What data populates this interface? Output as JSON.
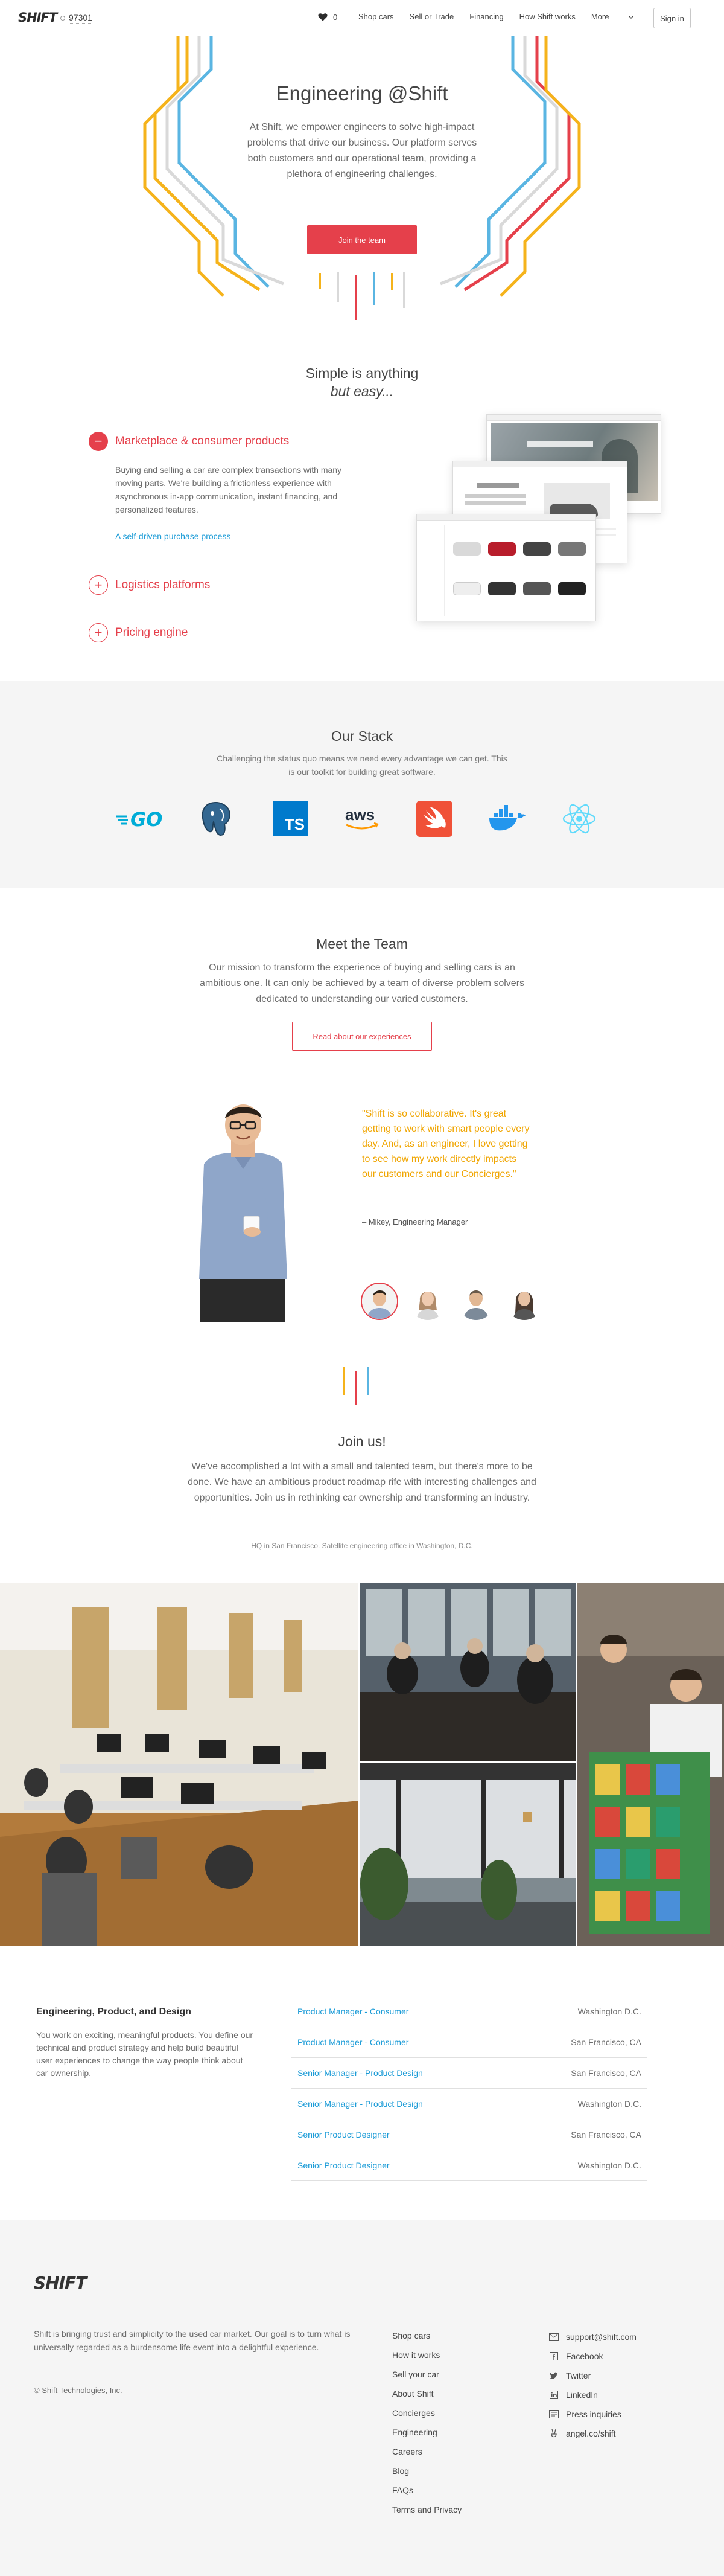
{
  "nav": {
    "logo": "SHIFT",
    "zip": "97301",
    "favorites_count": "0",
    "links": [
      "Shop cars",
      "Sell or Trade",
      "Financing",
      "How Shift works"
    ],
    "more": "More",
    "sign_in": "Sign in"
  },
  "hero": {
    "title": "Engineering @Shift",
    "text": "At Shift, we empower engineers to solve high-impact problems that drive our business. Our platform serves both customers and our operational team, providing a plethora of engineering challenges.",
    "button": "Join the team"
  },
  "simple": {
    "title_line1": "Simple is anything",
    "title_line2": "but easy...",
    "items": [
      {
        "label": "Marketplace & consumer products",
        "body": "Buying and selling a car are complex transactions with many moving parts. We're building a frictionless experience with asynchronous in-app communication, instant financing, and personalized features.",
        "link": "A self-driven purchase process"
      },
      {
        "label": "Logistics platforms"
      },
      {
        "label": "Pricing engine"
      }
    ]
  },
  "stack": {
    "title": "Our Stack",
    "text": "Challenging the status quo means we need every advantage we can get. This is our toolkit for building great software.",
    "logos": [
      "go-logo",
      "postgresql-logo",
      "typescript-logo",
      "aws-logo",
      "swift-logo",
      "docker-logo",
      "react-logo"
    ],
    "go_text": "GO",
    "ts_text": "TS",
    "aws_text": "aws"
  },
  "team": {
    "title": "Meet the Team",
    "text": "Our mission to transform the experience of buying and selling cars is an ambitious one. It can only be achieved by a team of diverse problem solvers dedicated to understanding our varied customers.",
    "button": "Read about our experiences",
    "quote": "\"Shift is so collaborative. It's great getting to work with smart people every day. And, as an engineer, I love getting to see how my work directly impacts our customers and our Concierges.\"",
    "quote_by": "– Mikey, Engineering Manager"
  },
  "join": {
    "title": "Join us!",
    "text": "We've accomplished a lot with a small and talented team, but there's more to be done. We have an ambitious product roadmap rife with interesting challenges and opportunities. Join us in rethinking car ownership and transforming an industry.",
    "hq": "HQ in San Francisco. Satellite engineering office in Washington, D.C."
  },
  "jobs": {
    "category": "Engineering, Product, and Design",
    "description": "You work on exciting, meaningful products. You define our technical and product strategy and help build beautiful user experiences to change the way people think about car ownership.",
    "listings": [
      {
        "title": "Product Manager - Consumer",
        "location": "Washington D.C."
      },
      {
        "title": "Product Manager - Consumer",
        "location": "San Francisco, CA"
      },
      {
        "title": "Senior Manager - Product Design",
        "location": "San Francisco, CA"
      },
      {
        "title": "Senior Manager - Product Design",
        "location": "Washington D.C."
      },
      {
        "title": "Senior Product Designer",
        "location": "San Francisco, CA"
      },
      {
        "title": "Senior Product Designer",
        "location": "Washington D.C."
      }
    ]
  },
  "footer": {
    "logo": "SHIFT",
    "text": "Shift is bringing trust and simplicity to the used car market. Our goal is to turn what is universally regarded as a burdensome life event into a delightful experience.",
    "copyright": "© Shift Technologies, Inc.",
    "links": [
      "Shop cars",
      "How it works",
      "Sell your car",
      "About Shift",
      "Concierges",
      "Engineering",
      "Careers",
      "Blog",
      "FAQs",
      "Terms and Privacy"
    ],
    "social": [
      {
        "label": "support@shift.com",
        "icon": "mail-icon"
      },
      {
        "label": "Facebook",
        "icon": "facebook-icon"
      },
      {
        "label": "Twitter",
        "icon": "twitter-icon"
      },
      {
        "label": "LinkedIn",
        "icon": "linkedin-icon"
      },
      {
        "label": "Press inquiries",
        "icon": "press-icon"
      },
      {
        "label": "angel.co/shift",
        "icon": "angel-icon"
      }
    ]
  },
  "colors": {
    "accent": "#e5404b",
    "link": "#1a9bd7",
    "quote": "#f0a500",
    "line_yellow": "#f5b31b",
    "line_blue": "#5ab5e2",
    "line_red": "#e5404b",
    "line_gray": "#d9d9d9"
  }
}
